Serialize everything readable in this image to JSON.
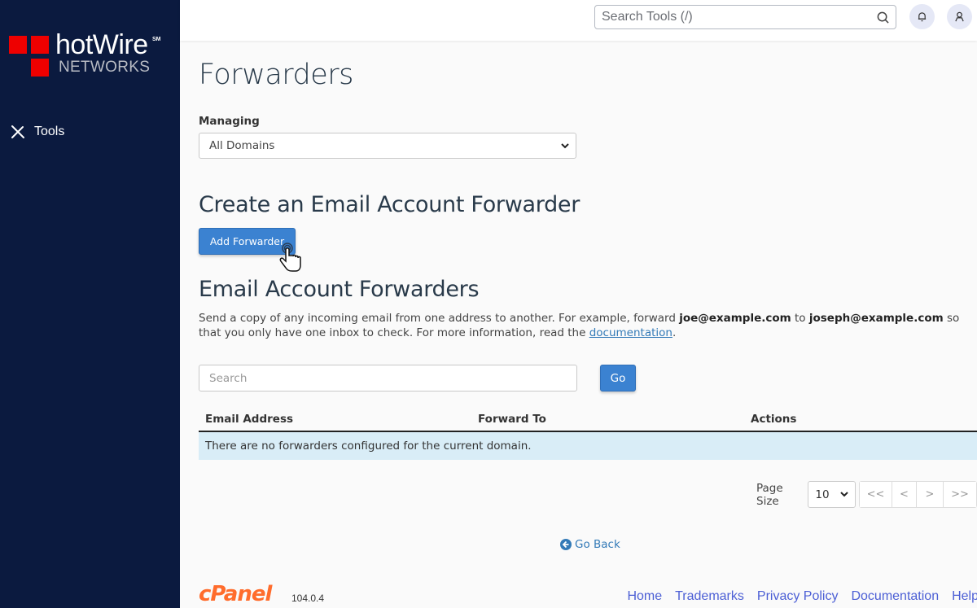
{
  "sidebar": {
    "logo": {
      "brand": "hotWire",
      "service_mark": "SM",
      "sub": "NETWORKS"
    },
    "items": [
      {
        "label": "Tools",
        "icon": "tools-icon"
      }
    ]
  },
  "topbar": {
    "search_placeholder": "Search Tools (/)",
    "icons": [
      "search-icon",
      "bell-icon",
      "user-icon"
    ]
  },
  "page": {
    "title": "Forwarders",
    "managing_label": "Managing",
    "managing_selected": "All Domains",
    "create_title": "Create an Email Account Forwarder",
    "add_button": "Add Forwarder",
    "list_title": "Email Account Forwarders",
    "description": {
      "part1": "Send a copy of any incoming email from one address to another. For example, forward ",
      "example_from": "joe@example.com",
      "part2": " to ",
      "example_to": "joseph@example.com",
      "part3": " so that you only have one inbox to check. For more information, read the ",
      "link": "documentation",
      "part4": "."
    },
    "search_placeholder": "Search",
    "go_button": "Go",
    "table": {
      "columns": [
        "Email Address",
        "Forward To",
        "Actions"
      ],
      "empty_message": "There are no forwarders configured for the current domain."
    },
    "pagination": {
      "page_size_label": "Page Size",
      "page_size": "10",
      "buttons": [
        "<<",
        "<",
        ">",
        ">>"
      ]
    },
    "go_back": "Go Back"
  },
  "footer": {
    "brand": "cPanel",
    "version": "104.0.4",
    "links": [
      "Home",
      "Trademarks",
      "Privacy Policy",
      "Documentation",
      "Help"
    ]
  },
  "colors": {
    "sidebar_bg": "#0b1a3f",
    "accent": "#3b82d1",
    "logo_red": "#ee0000",
    "cpanel_orange": "#ff6c2c",
    "info_row": "#d9edf7",
    "footer_link": "#4c5fd5"
  }
}
